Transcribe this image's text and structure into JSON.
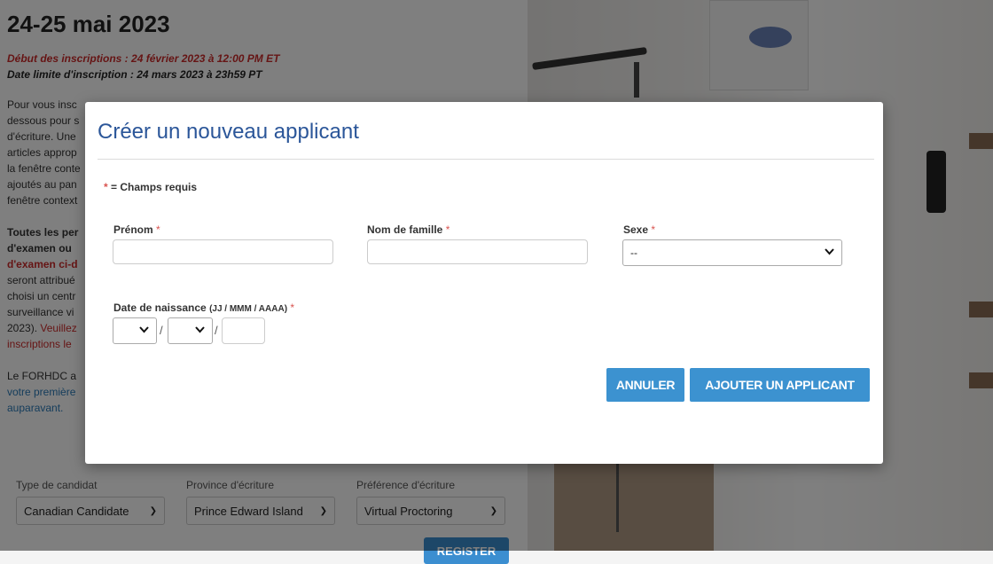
{
  "background": {
    "title": "24-25 mai 2023",
    "registration_start": "Début des inscriptions : 24 février 2023 à 12:00 PM ET",
    "registration_deadline": "Date limite d'inscription : 24 mars 2023 à 23h59 PT",
    "para1_lines": [
      "Pour vous insc",
      "dessous pour s",
      "d'écriture. Une",
      "articles approp",
      "la fenêtre conte",
      "ajoutés au pan",
      "fenêtre context"
    ],
    "bold_lines": [
      "Toutes les per",
      "d'examen ou"
    ],
    "red_bold_line": "d'examen ci-d",
    "para2_lines": [
      "seront attribué",
      "choisi un centr",
      "surveillance vi",
      "2023)."
    ],
    "para2_red_tail": "Veuillez",
    "para2_red_line": "inscriptions le",
    "para3_line": "Le FORHDC a",
    "para3_blue_lines": [
      "votre première",
      "auparavant."
    ],
    "form": {
      "candidate_type_label": "Type de candidat",
      "candidate_type_value": "Canadian Candidate",
      "province_label": "Province d'écriture",
      "province_value": "Prince Edward Island",
      "preference_label": "Préférence d'écriture",
      "preference_value": "Virtual Proctoring",
      "register_label": "REGISTER"
    }
  },
  "modal": {
    "title": "Créer un nouveau applicant",
    "required_note": "= Champs requis",
    "required_star": "*",
    "first_name": {
      "label": "Prénom",
      "value": ""
    },
    "last_name": {
      "label": "Nom de famille",
      "value": ""
    },
    "sex": {
      "label": "Sexe",
      "selected": "--"
    },
    "birthdate": {
      "label": "Date de naissance",
      "hint": "(JJ / MMM / AAAA)",
      "day": "",
      "month": "",
      "year": "",
      "separator": "/"
    },
    "cancel_label": "ANNULER",
    "add_label": "AJOUTER UN APPLICANT"
  },
  "colors": {
    "title_blue": "#2b5699",
    "button_blue": "#3c92d0",
    "required_red": "#d9534f"
  }
}
